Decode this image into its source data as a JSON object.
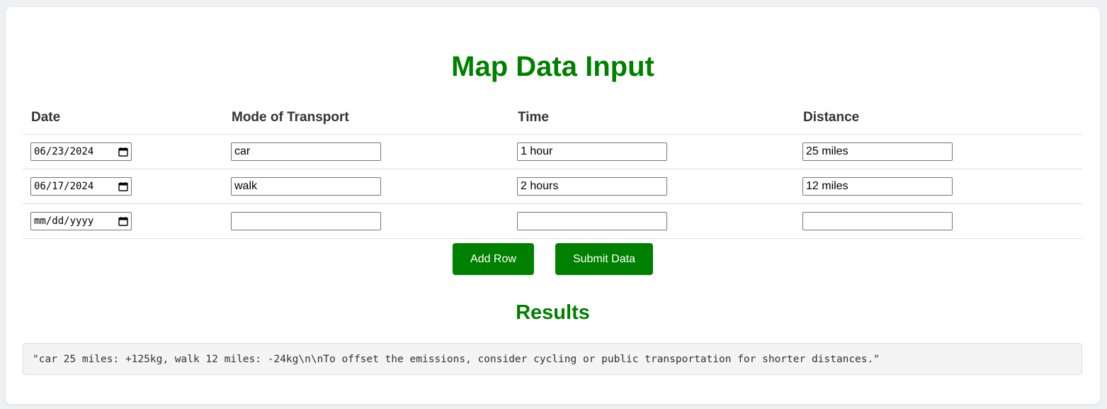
{
  "title": "Map Data Input",
  "table": {
    "headers": [
      "Date",
      "Mode of Transport",
      "Time",
      "Distance"
    ],
    "rows": [
      {
        "date": "06/23/2024",
        "mode": "car",
        "time": "1 hour",
        "distance": "25 miles"
      },
      {
        "date": "06/17/2024",
        "mode": "walk",
        "time": "2 hours",
        "distance": "12 miles"
      },
      {
        "date": "mm/dd/yyyy",
        "mode": "",
        "time": "",
        "distance": ""
      }
    ]
  },
  "buttons": {
    "add_row": "Add Row",
    "submit": "Submit Data"
  },
  "results": {
    "title": "Results",
    "text": "\"car 25 miles: +125kg, walk 12 miles: -24kg\\n\\nTo offset the emissions, consider cycling or public transportation for shorter distances.\""
  },
  "icons": {
    "date_picker": "calendar-icon"
  },
  "colors": {
    "accent": "#008000",
    "background": "#eef0f3",
    "results_bg": "#f4f4f4"
  }
}
